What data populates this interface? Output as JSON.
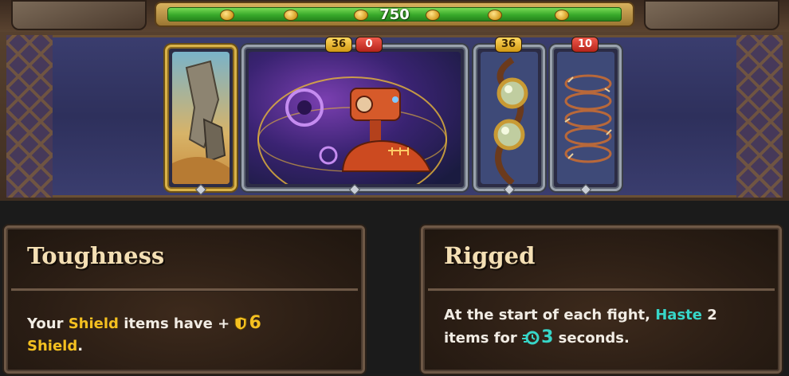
{
  "hud": {
    "gold_value": "750"
  },
  "board": {
    "cards": [
      {
        "name": "rock-card",
        "badges": []
      },
      {
        "name": "robot-card",
        "badges": [
          {
            "text": "36",
            "kind": "gold"
          },
          {
            "text": "0",
            "kind": "red"
          }
        ]
      },
      {
        "name": "goggles-card",
        "badges": [
          {
            "text": "36",
            "kind": "gold"
          }
        ]
      },
      {
        "name": "barbed-wire-card",
        "badges": [
          {
            "text": "10",
            "kind": "red"
          }
        ]
      }
    ]
  },
  "tooltips": {
    "toughness": {
      "title": "Toughness",
      "body_pre": "Your ",
      "keyword": "Shield",
      "body_mid": " items have +",
      "value": "6",
      "value_icon": "shield-icon",
      "tail_keyword": "Shield",
      "tail": "."
    },
    "rigged": {
      "title": "Rigged",
      "body_pre": "At the start of each fight, ",
      "keyword": "Haste",
      "body_mid": " 2",
      "line2_pre": "items for ",
      "value": "3",
      "value_icon": "haste-icon",
      "tail": " seconds."
    }
  },
  "colors": {
    "shield_keyword": "#f4c020",
    "haste_keyword": "#37d6c8",
    "title_text": "#f4dfb4"
  }
}
